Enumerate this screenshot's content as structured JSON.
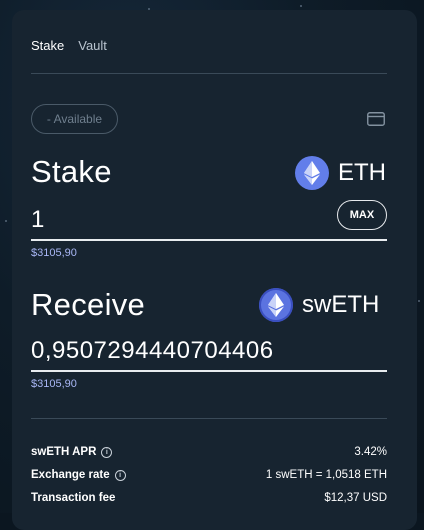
{
  "tabs": [
    {
      "label": "Stake",
      "active": true
    },
    {
      "label": "Vault",
      "active": false
    }
  ],
  "available": {
    "label": "- Available"
  },
  "icons": {
    "wallet": "wallet-card-icon",
    "eth": "ethereum-icon",
    "info": "info-circle-icon"
  },
  "stake": {
    "title": "Stake",
    "token": "ETH",
    "amount": "1",
    "max_label": "MAX",
    "usd_value": "$3105,90"
  },
  "receive": {
    "title": "Receive",
    "token": "swETH",
    "amount": "0,9507294440704406",
    "usd_value": "$3105,90"
  },
  "details": [
    {
      "label": "swETH APR",
      "value": "3.42%",
      "info": true
    },
    {
      "label": "Exchange rate",
      "value": "1 swETH = 1,0518 ETH",
      "info": true
    },
    {
      "label": "Transaction fee",
      "value": "$12,37 USD",
      "info": false
    }
  ],
  "colors": {
    "accent": "#627eea",
    "usd_text": "#a9b7f5",
    "card": "#172430"
  }
}
